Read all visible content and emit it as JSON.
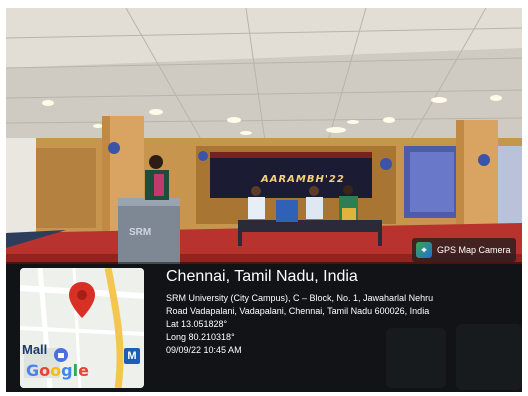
{
  "scene": {
    "banner_title": "AARAMBH'22",
    "podium_brand": "SRM"
  },
  "gps": {
    "badge_label": "GPS Map Camera",
    "location_title": "Chennai, Tamil Nadu, India",
    "address_line_1": "SRM University (City Campus), C – Block, No. 1, Jawaharlal Nehru",
    "address_line_2": "Road Vadapalani, Vadapalani, Chennai, Tamil Nadu 600026, India",
    "latitude": "Lat 13.051828°",
    "longitude": "Long 80.210318°",
    "timestamp": "09/09/22 10:45 AM"
  },
  "map": {
    "poi_label": "Mall",
    "logo_text": "Google",
    "metro_label": "M"
  },
  "colors": {
    "carpet": "#b8332e",
    "ceiling": "#d9d6cf",
    "pin": "#d93025",
    "overlay": "#000000"
  }
}
